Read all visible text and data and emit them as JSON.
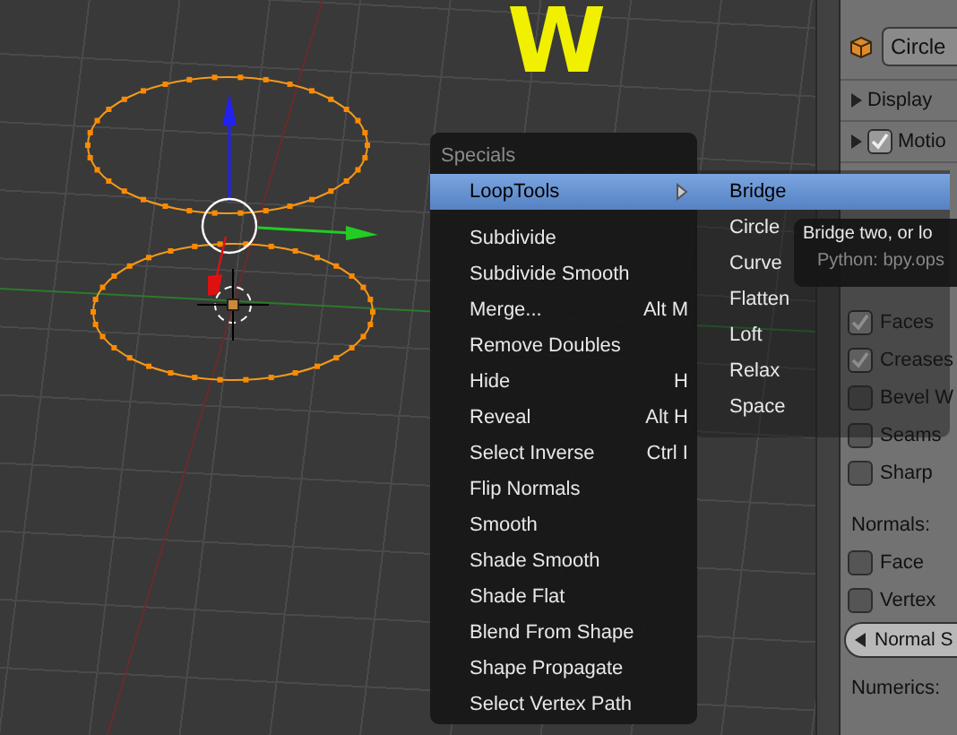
{
  "viewport": {
    "overlay_letter": "W"
  },
  "properties": {
    "object_field": "Circle",
    "panels": [
      {
        "label": "Display",
        "kind": "header"
      },
      {
        "label": "Motio",
        "kind": "checkheader",
        "checked": true
      }
    ],
    "overlay_options": [
      {
        "label": "Faces",
        "checked": true
      },
      {
        "label": "Creases",
        "checked": true
      },
      {
        "label": "Bevel W",
        "checked": false
      },
      {
        "label": "Seams",
        "checked": false
      },
      {
        "label": "Sharp",
        "checked": false
      }
    ],
    "normals_label": "Normals:",
    "normals_options": [
      {
        "label": "Face",
        "checked": false
      },
      {
        "label": "Vertex",
        "checked": false
      }
    ],
    "normal_size": "Normal S",
    "numerics_label": "Numerics:"
  },
  "menu": {
    "title": "Specials",
    "items": [
      {
        "label": "LoopTools",
        "kind": "submenu",
        "selected": true
      },
      {
        "label": "Subdivide",
        "kind": "action",
        "selected": false
      },
      {
        "label": "Subdivide Smooth",
        "kind": "action",
        "selected": false
      },
      {
        "label": "Merge...",
        "kind": "action",
        "selected": false,
        "shortcut": "Alt M"
      },
      {
        "label": "Remove Doubles",
        "kind": "action",
        "selected": false
      },
      {
        "label": "Hide",
        "kind": "action",
        "selected": false,
        "shortcut": "H"
      },
      {
        "label": "Reveal",
        "kind": "action",
        "selected": false,
        "shortcut": "Alt H"
      },
      {
        "label": "Select Inverse",
        "kind": "action",
        "selected": false,
        "shortcut": "Ctrl I"
      },
      {
        "label": "Flip Normals",
        "kind": "action",
        "selected": false
      },
      {
        "label": "Smooth",
        "kind": "action",
        "selected": false
      },
      {
        "label": "Shade Smooth",
        "kind": "action",
        "selected": false
      },
      {
        "label": "Shade Flat",
        "kind": "action",
        "selected": false
      },
      {
        "label": "Blend From Shape",
        "kind": "action",
        "selected": false
      },
      {
        "label": "Shape Propagate",
        "kind": "action",
        "selected": false
      },
      {
        "label": "Select Vertex Path",
        "kind": "action",
        "selected": false
      }
    ]
  },
  "submenu": {
    "items": [
      {
        "label": "Bridge",
        "selected": true
      },
      {
        "label": "Circle",
        "selected": false
      },
      {
        "label": "Curve",
        "selected": false
      },
      {
        "label": "Flatten",
        "selected": false
      },
      {
        "label": "Loft",
        "selected": false
      },
      {
        "label": "Relax",
        "selected": false
      },
      {
        "label": "Space",
        "selected": false
      }
    ]
  },
  "tooltip": {
    "text": "Bridge two, or lo",
    "python": "Python: bpy.ops"
  }
}
